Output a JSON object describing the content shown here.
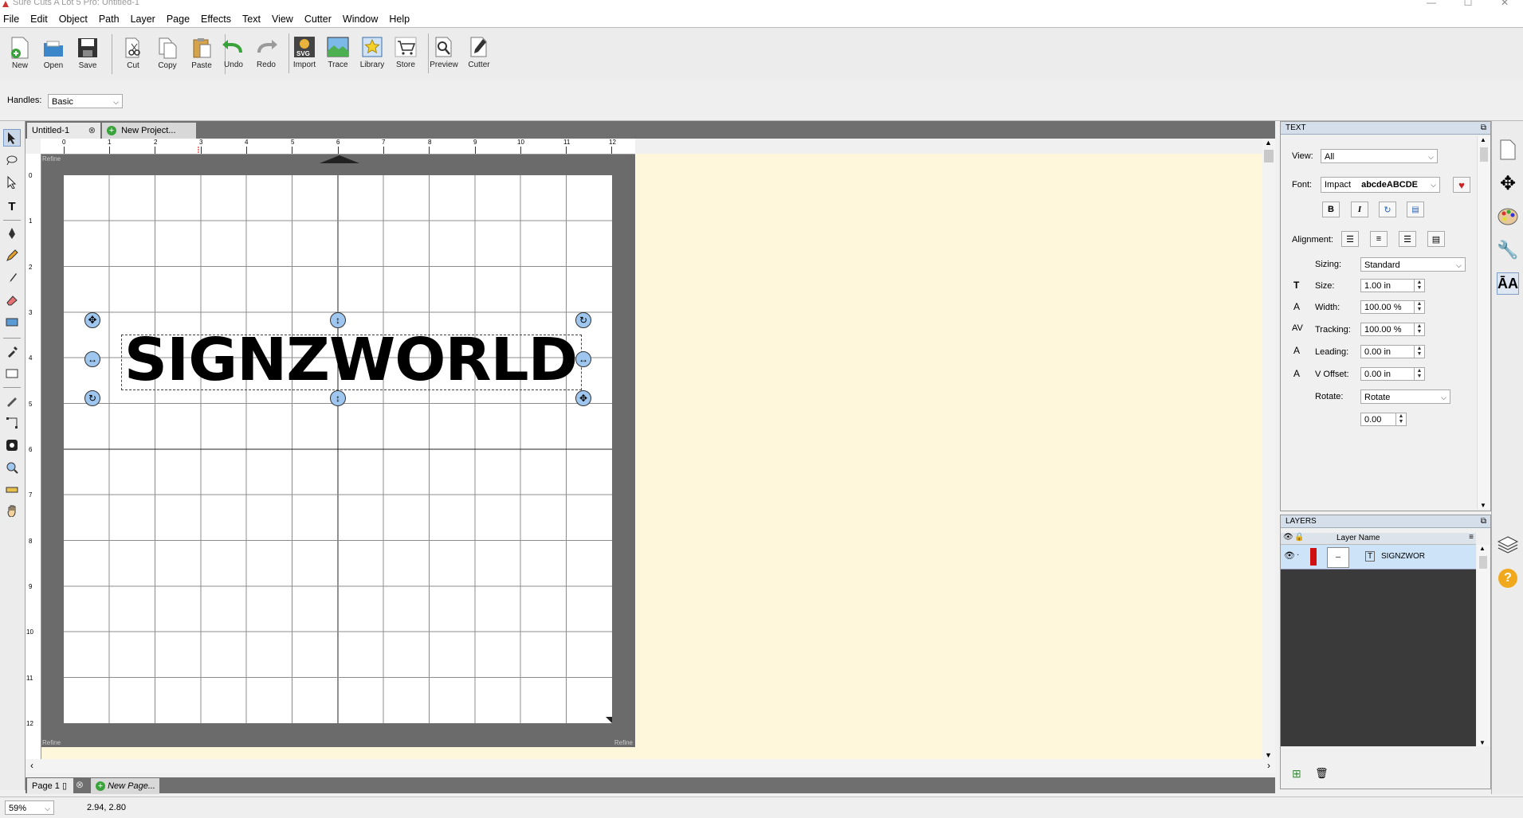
{
  "window": {
    "title": "Sure Cuts A Lot 5 Pro: Untitled-1",
    "controls": [
      "—",
      "☐",
      "✕"
    ]
  },
  "menu": [
    "File",
    "Edit",
    "Object",
    "Path",
    "Layer",
    "Page",
    "Effects",
    "Text",
    "View",
    "Cutter",
    "Window",
    "Help"
  ],
  "toolbar": {
    "new": "New",
    "open": "Open",
    "save": "Save",
    "cut": "Cut",
    "copy": "Copy",
    "paste": "Paste",
    "undo": "Undo",
    "redo": "Redo",
    "import": "Import",
    "trace": "Trace",
    "library": "Library",
    "store": "Store",
    "preview": "Preview",
    "cutter": "Cutter"
  },
  "handles": {
    "label": "Handles:",
    "value": "Basic"
  },
  "tabs": {
    "doc": "Untitled-1",
    "new_project": "New Project..."
  },
  "canvas": {
    "text": "SIGNZWORLD",
    "h_ticks": [
      "0",
      "1",
      "2",
      "3",
      "4",
      "5",
      "6",
      "7",
      "8",
      "9",
      "10",
      "11",
      "12"
    ],
    "v_ticks": [
      "0",
      "1",
      "2",
      "3",
      "4",
      "5",
      "6",
      "7",
      "8",
      "9",
      "10",
      "11",
      "12"
    ],
    "refine": "Refine"
  },
  "pages": {
    "page": "Page 1",
    "new_page": "New Page..."
  },
  "status": {
    "zoom": "59%",
    "coords": "2.94, 2.80"
  },
  "text_panel": {
    "title": "TEXT",
    "view_label": "View:",
    "view_value": "All",
    "font_label": "Font:",
    "font_value": "Impact",
    "font_preview": "abcdeABCDE",
    "alignment_label": "Alignment:",
    "sizing_label": "Sizing:",
    "sizing_value": "Standard",
    "size_label": "Size:",
    "size_value": "1.00 in",
    "width_label": "Width:",
    "width_value": "100.00 %",
    "tracking_label": "Tracking:",
    "tracking_value": "100.00 %",
    "leading_label": "Leading:",
    "leading_value": "0.00 in",
    "voffset_label": "V Offset:",
    "voffset_value": "0.00 in",
    "rotate_label": "Rotate:",
    "rotate_value": "Rotate",
    "rotate_angle": "0.00"
  },
  "layers_panel": {
    "title": "LAYERS",
    "col_name": "Layer Name",
    "rows": [
      {
        "name": "SIGNZWOR",
        "color": "#d01010"
      }
    ]
  },
  "colors": {
    "accent_blue": "#9ec6ee",
    "mat": "#6b6b6b",
    "workarea": "#fff7dc",
    "layer_color": "#d01010"
  }
}
